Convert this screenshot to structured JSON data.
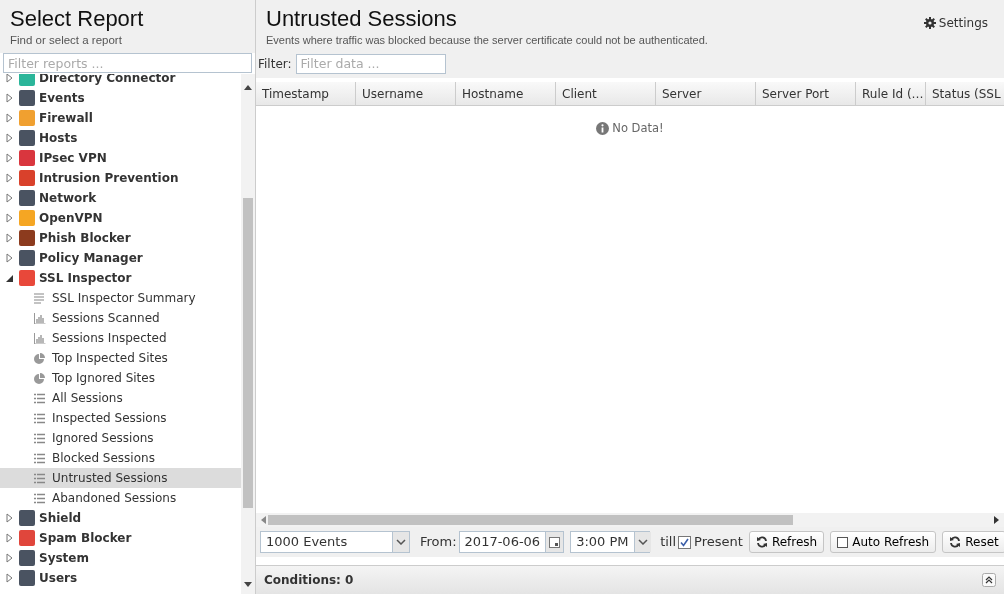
{
  "sidebar": {
    "title": "Select Report",
    "subtitle": "Find or select a report",
    "filter": {
      "placeholder": "Filter reports ..."
    },
    "items": [
      {
        "label": "Directory Connector",
        "color": "#2bb59a",
        "expanded": false
      },
      {
        "label": "Events",
        "color": "#4a5361",
        "expanded": false
      },
      {
        "label": "Firewall",
        "color": "#f0a030",
        "expanded": false
      },
      {
        "label": "Hosts",
        "color": "#4a5361",
        "expanded": false
      },
      {
        "label": "IPsec VPN",
        "color": "#d9363e",
        "expanded": false
      },
      {
        "label": "Intrusion Prevention",
        "color": "#d9412b",
        "expanded": false
      },
      {
        "label": "Network",
        "color": "#4a5361",
        "expanded": false
      },
      {
        "label": "OpenVPN",
        "color": "#f5a623",
        "expanded": false
      },
      {
        "label": "Phish Blocker",
        "color": "#8c3b1e",
        "expanded": false
      },
      {
        "label": "Policy Manager",
        "color": "#4a5361",
        "expanded": false
      },
      {
        "label": "SSL Inspector",
        "color": "#e8483a",
        "expanded": true,
        "children": [
          {
            "label": "SSL Inspector Summary",
            "kind": "summary",
            "selected": false
          },
          {
            "label": "Sessions Scanned",
            "kind": "bar",
            "selected": false
          },
          {
            "label": "Sessions Inspected",
            "kind": "bar",
            "selected": false
          },
          {
            "label": "Top Inspected Sites",
            "kind": "pie",
            "selected": false
          },
          {
            "label": "Top Ignored Sites",
            "kind": "pie",
            "selected": false
          },
          {
            "label": "All Sessions",
            "kind": "list",
            "selected": false
          },
          {
            "label": "Inspected Sessions",
            "kind": "list",
            "selected": false
          },
          {
            "label": "Ignored Sessions",
            "kind": "list",
            "selected": false
          },
          {
            "label": "Blocked Sessions",
            "kind": "list",
            "selected": false
          },
          {
            "label": "Untrusted Sessions",
            "kind": "list",
            "selected": true
          },
          {
            "label": "Abandoned Sessions",
            "kind": "list",
            "selected": false
          }
        ]
      },
      {
        "label": "Shield",
        "color": "#4a5361",
        "expanded": false
      },
      {
        "label": "Spam Blocker",
        "color": "#e0463c",
        "expanded": false
      },
      {
        "label": "System",
        "color": "#4a5361",
        "expanded": false
      },
      {
        "label": "Users",
        "color": "#4a5361",
        "expanded": false
      }
    ]
  },
  "report": {
    "title": "Untrusted Sessions",
    "description": "Events where traffic was blocked because the server certificate could not be authenticated.",
    "settings": "Settings",
    "filter": {
      "label": "Filter:",
      "placeholder": "Filter data ..."
    },
    "table": {
      "columns": [
        "Timestamp",
        "Username",
        "Hostname",
        "Client",
        "Server",
        "Server Port",
        "Rule Id (…",
        "Status (SSL"
      ],
      "empty_message": "No Data!"
    },
    "toolbar": {
      "limit": "1000 Events",
      "from_label": "From:",
      "date": "2017-06-06",
      "time": "3:00 PM",
      "till_label": "till",
      "present": {
        "label": "Present",
        "checked": true
      },
      "refresh": "Refresh",
      "auto_refresh": {
        "label": "Auto Refresh",
        "checked": false
      },
      "reset": "Reset"
    },
    "conditions": "Conditions: 0"
  }
}
